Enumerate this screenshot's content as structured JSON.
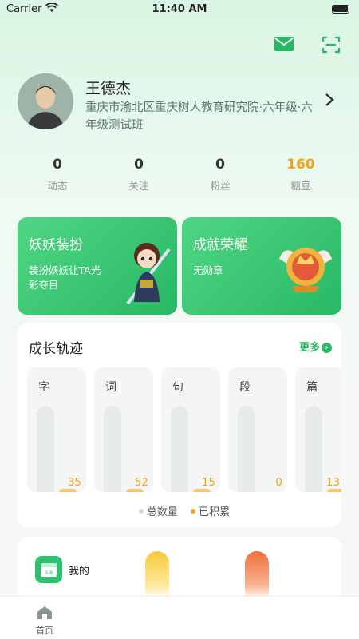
{
  "status_bar": {
    "carrier": "Carrier",
    "time": "11:40 AM"
  },
  "profile": {
    "name": "王德杰",
    "school": "重庆市渝北区重庆树人教育研究院·六年级·六年级测试班"
  },
  "stats": [
    {
      "value": "0",
      "label": "动态"
    },
    {
      "value": "0",
      "label": "关注"
    },
    {
      "value": "0",
      "label": "粉丝"
    },
    {
      "value": "160",
      "label": "糖豆"
    }
  ],
  "cards": {
    "dress": {
      "title": "妖妖装扮",
      "subtitle": "装扮妖妖让TA光彩夺目"
    },
    "honor": {
      "title": "成就荣耀",
      "subtitle": "无勋章"
    }
  },
  "growth": {
    "title": "成长轨迹",
    "more_label": "更多",
    "columns": [
      {
        "label": "字",
        "value": "35"
      },
      {
        "label": "词",
        "value": "52"
      },
      {
        "label": "句",
        "value": "15"
      },
      {
        "label": "段",
        "value": "0"
      },
      {
        "label": "篇",
        "value": "13"
      }
    ],
    "legend": {
      "total": "总数量",
      "accumulated": "已积累"
    }
  },
  "bottom_card": {
    "label": "我的",
    "icon_text": "3-8"
  },
  "tabbar": {
    "home_label": "首页"
  },
  "colors": {
    "accent": "#2bb866",
    "orange": "#f2a51a"
  }
}
